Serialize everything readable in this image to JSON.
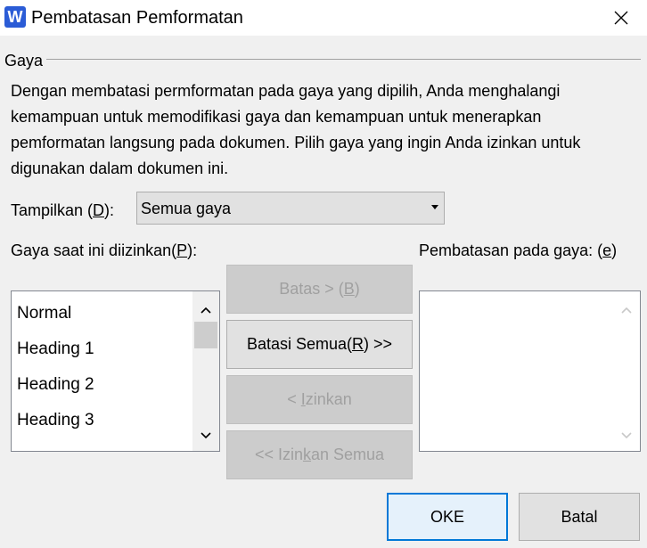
{
  "window": {
    "title": "Pembatasan Pemformatan",
    "app_icon_letter": "W",
    "colors": {
      "app_icon": "#2b5cd6",
      "default_button_border": "#0078d7"
    }
  },
  "group": {
    "label": "Gaya",
    "description": "Dengan membatasi permformatan pada gaya yang dipilih, Anda menghalangi kemampuan untuk memodifikasi gaya dan kemampuan untuk menerapkan pemformatan langsung pada dokumen. Pilih gaya yang ingin Anda izinkan untuk digunakan dalam dokumen ini."
  },
  "show": {
    "label_pre": "Tampilkan (",
    "label_key": "D",
    "label_post": "):",
    "selected": "Semua gaya"
  },
  "allowed": {
    "label_pre": "Gaya saat ini diizinkan(",
    "label_key": "P",
    "label_post": "):",
    "items": [
      "Normal",
      "Heading 1",
      "Heading 2",
      "Heading 3"
    ]
  },
  "restricted": {
    "label_pre": "Pembatasan pada gaya: (",
    "label_key": "e",
    "label_post": ")",
    "items": []
  },
  "buttons": {
    "restrict": {
      "pre": "Batas > (",
      "key": "B",
      "post": ")"
    },
    "restrict_all": {
      "pre": "Batasi Semua(",
      "key": "R",
      "post": ") >>"
    },
    "allow": {
      "pre": "< ",
      "key": "I",
      "post": "zinkan"
    },
    "allow_all": {
      "pre": "<< Izin",
      "key": "k",
      "post": "an Semua"
    },
    "ok": "OKE",
    "cancel": "Batal"
  }
}
